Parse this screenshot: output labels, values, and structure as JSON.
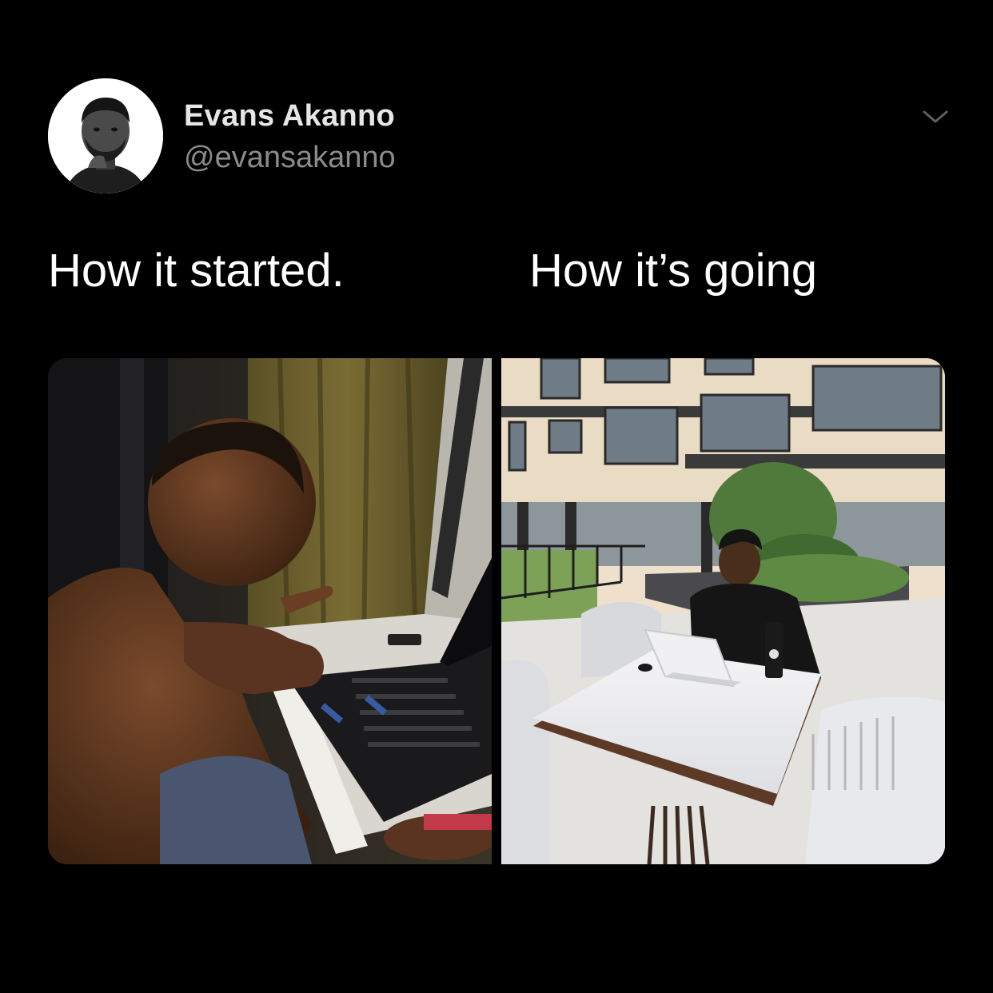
{
  "tweet": {
    "author": {
      "display_name": "Evans Akanno",
      "handle": "@evansakanno",
      "avatar_icon": "avatar-photo"
    },
    "more_icon": "chevron-down-icon",
    "captions": {
      "left": "How it started.",
      "right": "How it’s going"
    },
    "media": {
      "left_photo": "photo-man-at-laptop-dark-room",
      "right_photo": "photo-man-at-laptop-outdoor-terrace"
    }
  },
  "colors": {
    "background": "#000000",
    "name": "#e6e6e6",
    "handle": "#8b8b8b",
    "caption": "#ffffff"
  }
}
